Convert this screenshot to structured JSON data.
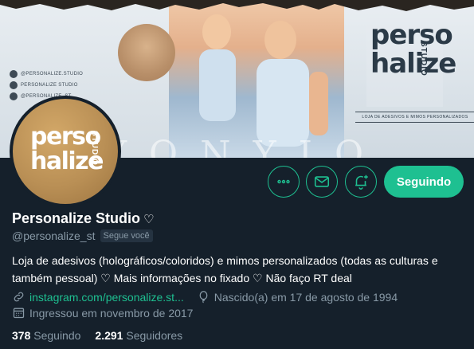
{
  "banner": {
    "social_lines": [
      "@PERSONALIZE.STUDIO",
      "PERSONALIZE STUDIO",
      "@PERSONALIZE_ST"
    ],
    "logo_line1": "perso",
    "logo_line2": "halize",
    "logo_studio": "STUDIO",
    "tagline": "LOJA DE ADESIVOS E MIMOS PERSONALIZADOS",
    "background_text": "YONYIO"
  },
  "avatar": {
    "logo_line1": "perso",
    "logo_line2": "halize",
    "logo_studio": "STUDIO"
  },
  "actions": {
    "more_icon": "more-horizontal-icon",
    "message_icon": "envelope-icon",
    "notify_icon": "bell-plus-icon",
    "follow_label": "Seguindo"
  },
  "profile": {
    "name": "Personalize Studio",
    "name_symbol": "♡",
    "handle": "@personalize_st",
    "follows_you": "Segue você",
    "bio": "Loja de adesivos (holográficos/coloridos) e mimos personalizados (todas as culturas e também pessoal) ♡ Mais informações no fixado ♡ Não faço RT deal",
    "website": "instagram.com/personalize.st...",
    "birthday": "Nascido(a) em 17 de agosto de 1994",
    "joined": "Ingressou em novembro de 2017"
  },
  "stats": {
    "following_count": "378",
    "following_label": "Seguindo",
    "followers_count": "2.291",
    "followers_label": "Seguidores"
  },
  "colors": {
    "background": "#15202b",
    "accent": "#1ec091",
    "secondary_text": "#8899a6"
  }
}
